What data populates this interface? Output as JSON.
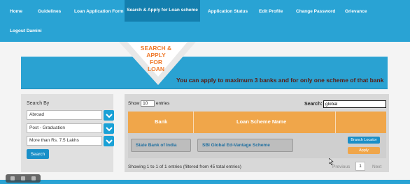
{
  "nav": {
    "items": [
      {
        "label": "Home"
      },
      {
        "label": "Guidelines"
      },
      {
        "label": "Loan Application Form"
      },
      {
        "label": "Search & Apply for Loan scheme",
        "active": true
      },
      {
        "label": "Application Status"
      },
      {
        "label": "Edit Profile"
      },
      {
        "label": "Change Password"
      },
      {
        "label": "Grievance"
      },
      {
        "label": "Logout Damini"
      }
    ]
  },
  "banner": {
    "flag_lines": [
      "SEARCH &",
      "APPLY",
      "FOR",
      "LOAN"
    ],
    "notice": "You can apply to maximum 3 banks and for only one scheme of that bank"
  },
  "search_panel": {
    "label": "Search By",
    "filters": [
      {
        "selected": "Abroad"
      },
      {
        "selected": "Post - Graduation"
      },
      {
        "selected": "More than Rs. 7.5 Lakhs"
      }
    ],
    "search_button": "Search"
  },
  "results": {
    "show_prefix": "Show",
    "page_size": "10",
    "show_suffix": "entries",
    "search_label": "Search:",
    "search_value": "global",
    "columns": [
      "Bank",
      "Loan Scheme Name"
    ],
    "rows": [
      {
        "bank": "State Bank of India",
        "scheme": "SBI Global Ed-Vantage Scheme",
        "branch_button": "Branch Locator",
        "apply_button": "Apply"
      }
    ],
    "info": "Showing 1 to 1 of 1 entries (filtered from 45 total entries)",
    "pager": {
      "prev": "Previous",
      "page": "1",
      "next": "Next"
    }
  },
  "colors": {
    "nav_bg": "#29a3d4",
    "nav_active": "#147fae",
    "header_orange": "#f0a64a",
    "flag_text": "#ef7a2c",
    "button_blue": "#1a8fc8"
  }
}
